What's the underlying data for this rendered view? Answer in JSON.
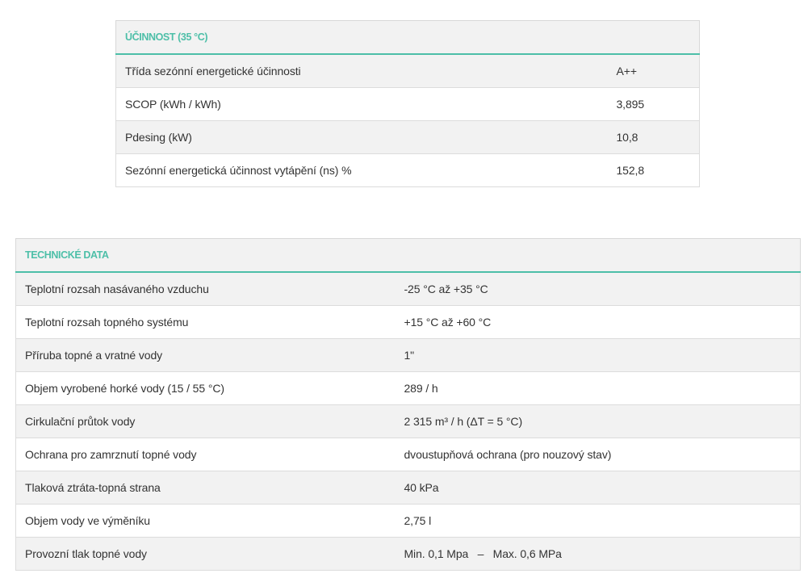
{
  "efficiency": {
    "title": "ÚČINNOST (35 °C)",
    "rows": [
      {
        "label": "Třída sezónní energetické účinnosti",
        "value": "A++"
      },
      {
        "label": "SCOP (kWh / kWh)",
        "value": "3,895"
      },
      {
        "label": "Pdesing (kW)",
        "value": "10,8"
      },
      {
        "label": "Sezónní energetická účinnost vytápění (ns) %",
        "value": "152,8"
      }
    ]
  },
  "technical": {
    "title": "TECHNICKÉ DATA",
    "rows": [
      {
        "label": "Teplotní rozsah nasávaného vzduchu",
        "value": "-25 °C až +35 °C"
      },
      {
        "label": "Teplotní rozsah topného systému",
        "value": "+15 °C až +60 °C"
      },
      {
        "label": "Příruba topné a vratné vody",
        "value": "1\""
      },
      {
        "label": "Objem vyrobené horké vody (15 / 55 °C)",
        "value": "289 / h"
      },
      {
        "label": "Cirkulační průtok vody",
        "value": "2 315 m³ / h (ΔT = 5 °C)"
      },
      {
        "label": "Ochrana pro zamrznutí topné vody",
        "value": "dvoustupňová ochrana (pro nouzový stav)"
      },
      {
        "label": "Tlaková ztráta-topná strana",
        "value": "40 kPa"
      },
      {
        "label": "Objem vody ve výměníku",
        "value": "2,75 l"
      },
      {
        "label": "Provozní tlak topné vody",
        "value": "Min. 0,1 Mpa   –   Max. 0,6 MPa"
      }
    ]
  }
}
